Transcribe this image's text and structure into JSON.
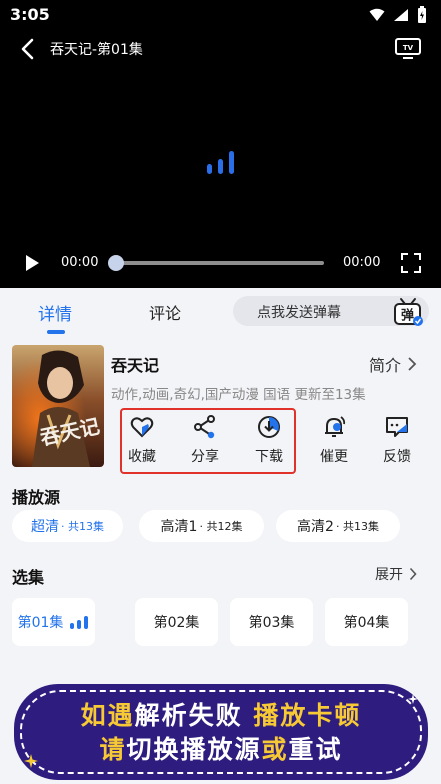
{
  "status_bar": {
    "time": "3:05"
  },
  "player": {
    "title": "吞天记-第01集",
    "current_time": "00:00",
    "total_time": "00:00",
    "progress": 0
  },
  "tabs": {
    "details": "详情",
    "comments": "评论",
    "danmaku_placeholder": "点我发送弹幕",
    "danmaku_badge": "弹"
  },
  "show": {
    "title": "吞天记",
    "intro_label": "简介",
    "meta": "动作,动画,奇幻,国产动漫 国语 更新至13集",
    "poster_text": "吞天记"
  },
  "actions": [
    {
      "label": "收藏",
      "icon": "heart-icon"
    },
    {
      "label": "分享",
      "icon": "share-icon"
    },
    {
      "label": "下载",
      "icon": "download-icon"
    },
    {
      "label": "催更",
      "icon": "bell-icon"
    },
    {
      "label": "反馈",
      "icon": "feedback-icon"
    }
  ],
  "sources": {
    "title": "播放源",
    "items": [
      {
        "name": "超清",
        "count": "· 共13集",
        "active": true
      },
      {
        "name": "高清1",
        "count": "· 共12集",
        "active": false
      },
      {
        "name": "高清2",
        "count": "· 共13集",
        "active": false
      }
    ]
  },
  "episodes": {
    "title": "选集",
    "expand_label": "展开",
    "items": [
      "第01集",
      "第02集",
      "第03集",
      "第04集"
    ]
  },
  "banner": {
    "l1_a": "如遇",
    "l1_b": "解析失败",
    "l1_c": " 播放卡顿",
    "l2_a": "请",
    "l2_b": "切换播放源",
    "l2_c": "或",
    "l2_d": "重试"
  },
  "colors": {
    "accent": "#2273ec",
    "highlight_border": "#e0322a",
    "banner_bg": "#2e1d7e",
    "banner_highlight": "#f7c934"
  }
}
